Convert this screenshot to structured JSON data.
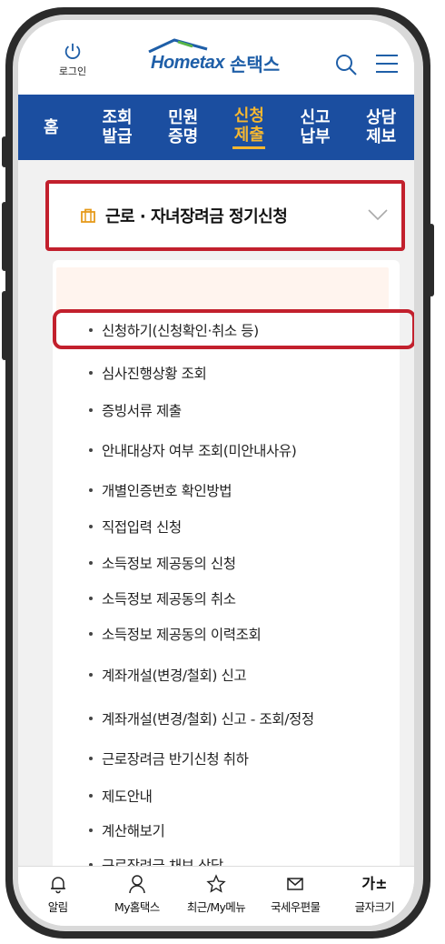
{
  "header": {
    "login_label": "로그인",
    "brand_text": "Hometax",
    "brand_suffix": "손택스",
    "search_icon": "search-icon",
    "menu_icon": "hamburger-menu-icon"
  },
  "nav": {
    "items": [
      {
        "label1": "홈",
        "label2": ""
      },
      {
        "label1": "조회",
        "label2": "발급"
      },
      {
        "label1": "민원",
        "label2": "증명"
      },
      {
        "label1": "신청",
        "label2": "제출"
      },
      {
        "label1": "신고",
        "label2": "납부"
      },
      {
        "label1": "상담",
        "label2": "제보"
      }
    ],
    "active_index": 3
  },
  "dropdown": {
    "icon": "bag-icon",
    "title": "근로 · 자녀장려금 정기신청"
  },
  "menu_items": [
    "신청하기(신청확인·취소 등)",
    "심사진행상황 조회",
    "증빙서류 제출",
    "안내대상자 여부 조회(미안내사유)",
    "개별인증번호 확인방법",
    "직접입력 신청",
    "소득정보 제공동의 신청",
    "소득정보 제공동의 취소",
    "소득정보 제공동의 이력조회",
    "계좌개설(변경/철회) 신고",
    "계좌개설(변경/철회) 신고 - 조회/정정",
    "근로장려금 반기신청 취하",
    "제도안내",
    "계산해보기",
    "근로장려금 채보 상담"
  ],
  "bottom_bar": {
    "items": [
      {
        "icon": "bell-icon",
        "label": "알림"
      },
      {
        "icon": "person-icon",
        "label": "My홈택스"
      },
      {
        "icon": "star-icon",
        "label": "최근/My메뉴"
      },
      {
        "icon": "mail-icon",
        "label": "국세우편물"
      },
      {
        "icon": "font-size-icon",
        "label": "글자크기",
        "glyph": "가±"
      }
    ]
  },
  "colors": {
    "nav_bg": "#1b4ea0",
    "active": "#f5b731",
    "highlight": "#c2202d",
    "brand": "#1f5fa8"
  }
}
